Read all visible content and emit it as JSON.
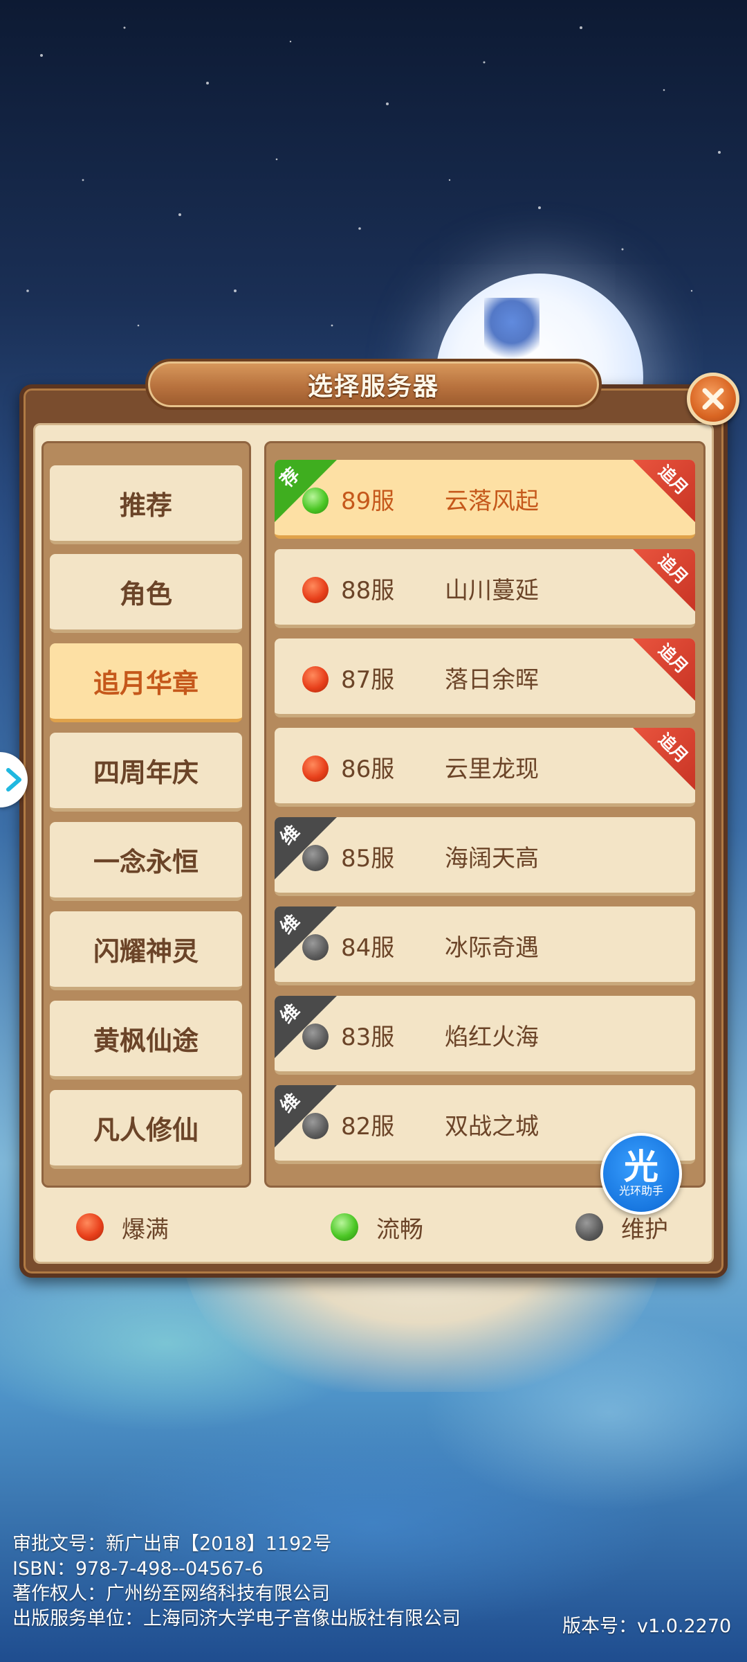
{
  "dialog": {
    "title": "选择服务器"
  },
  "categories": [
    {
      "label": "推荐",
      "active": false
    },
    {
      "label": "角色",
      "active": false
    },
    {
      "label": "追月华章",
      "active": true
    },
    {
      "label": "四周年庆",
      "active": false
    },
    {
      "label": "一念永恒",
      "active": false
    },
    {
      "label": "闪耀神灵",
      "active": false
    },
    {
      "label": "黄枫仙途",
      "active": false
    },
    {
      "label": "凡人修仙",
      "active": false
    }
  ],
  "servers": [
    {
      "num": "89服",
      "name": "云落风起",
      "status": "green",
      "tag": "荐",
      "ribbon": "追月",
      "active": true
    },
    {
      "num": "88服",
      "name": "山川蔓延",
      "status": "red",
      "tag": "",
      "ribbon": "追月",
      "active": false
    },
    {
      "num": "87服",
      "name": "落日余晖",
      "status": "red",
      "tag": "",
      "ribbon": "追月",
      "active": false
    },
    {
      "num": "86服",
      "name": "云里龙现",
      "status": "red",
      "tag": "",
      "ribbon": "追月",
      "active": false
    },
    {
      "num": "85服",
      "name": "海阔天高",
      "status": "gray",
      "tag": "维",
      "ribbon": "",
      "active": false
    },
    {
      "num": "84服",
      "name": "冰际奇遇",
      "status": "gray",
      "tag": "维",
      "ribbon": "",
      "active": false
    },
    {
      "num": "83服",
      "name": "焰红火海",
      "status": "gray",
      "tag": "维",
      "ribbon": "",
      "active": false
    },
    {
      "num": "82服",
      "name": "双战之城",
      "status": "gray",
      "tag": "维",
      "ribbon": "",
      "active": false
    }
  ],
  "legend": {
    "full": "爆满",
    "smooth": "流畅",
    "maintenance": "维护"
  },
  "helper": {
    "icon_text": "光",
    "label": "光环助手"
  },
  "footer": {
    "approval": "审批文号：新广出审【2018】1192号",
    "isbn": "ISBN：978-7-498--04567-6",
    "copyright": "著作权人：广州纷至网络科技有限公司",
    "publisher": "出版服务单位：上海同济大学电子音像出版社有限公司",
    "version": "版本号：v1.0.2270"
  },
  "colors": {
    "status_red": "#e8401b",
    "status_green": "#4cc726",
    "status_gray": "#5e5e5e",
    "tag_green": "#3fae1f",
    "tag_gray": "#4a4a4a",
    "ribbon_red": "#d63c28",
    "active_text": "#c5581b"
  }
}
